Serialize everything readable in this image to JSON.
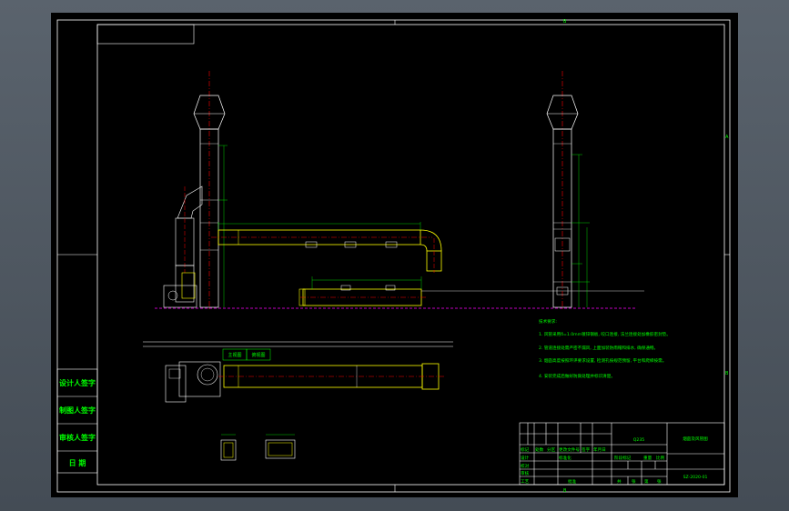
{
  "frame": {
    "zone_marks": {
      "top_mid": "B",
      "bottom_mid": "B",
      "right_top": "A",
      "right_mid": "B"
    }
  },
  "sign_block": {
    "rows": [
      "设计人签字",
      "制图人签字",
      "审核人签字",
      "日 期"
    ]
  },
  "view_labels": {
    "plan_tag_1": "主视图",
    "plan_tag_2": "俯视图"
  },
  "notes": {
    "title": "技术要求:",
    "items": [
      "1. 风管采用δ=1.0mm镀锌钢板, 咬口连接, 法兰连接处加橡胶密封垫。",
      "2. 管道连接处需严密不漏风, 上面加装防雨帽和排水, 确保通畅。",
      "3. 烟囱高度按照环评要求设置, 检测孔按规范预留, 平台和爬梯按需。",
      "4. 安装完成后做好防腐处理并标识清楚。"
    ]
  },
  "title_block": {
    "material_label": "Q235",
    "drawing_title": "烟囱及风管图",
    "drawing_number": "SZ-2020-01",
    "rows": {
      "r1": [
        "标记",
        "处数",
        "分区",
        "更改文件号",
        "签字",
        "年月日"
      ],
      "r2": [
        "设计",
        "",
        "标准化"
      ],
      "r3": [
        "校对",
        ""
      ],
      "r4": [
        "审核",
        ""
      ],
      "r5": [
        "工艺",
        "",
        "批准"
      ],
      "stage_cells": [
        "阶段标记",
        "重量",
        "比例"
      ],
      "sheet_cells": [
        "共",
        "张",
        "第",
        "张"
      ]
    }
  },
  "colors": {
    "background": "#000000",
    "frame_line": "#ffffff",
    "duct_outline": "#ffff00",
    "centerline": "#ff0000",
    "dimension": "#00ff00",
    "ground_line": "#ff00ff",
    "equipment": "#ffffff"
  }
}
